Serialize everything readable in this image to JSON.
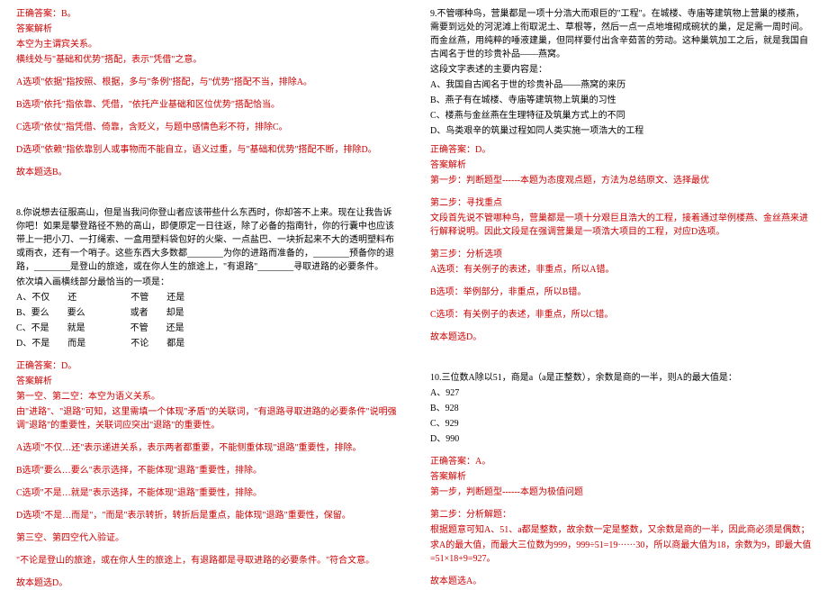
{
  "left": {
    "q7_answer_header": "正确答案：B。",
    "q7_explain_header": "答案解析",
    "q7_line1": "本空为主谓宾关系。",
    "q7_line2": "横线处与\"基础和优势\"搭配，表示\"凭借\"之意。",
    "q7_optA": "A选项\"依据\"指按照、根据，多与\"条例\"搭配，与\"优势\"搭配不当，排除A。",
    "q7_optB": "B选项\"依托\"指依靠、凭借，\"依托产业基础和区位优势\"搭配恰当。",
    "q7_optC": "C选项\"依仗\"指凭借、倚靠，含贬义，与题中感情色彩不符，排除C。",
    "q7_optD": "D选项\"依赖\"指依靠别人或事物而不能自立，语义过重，与\"基础和优势\"搭配不断，排除D。",
    "q7_conclusion": "故本题选B。",
    "q8_num": "8.",
    "q8_text": "你说想去征服高山，但是当我问你登山者应该带些什么东西时，你却答不上来。现在让我告诉你吧！如果是攀登路径不熟的高山，即便原定一日往返，除了必备的指南针，你的行囊中也应该带上一把小刀、一打绳索、一盒用塑料袋包好的火柴、一点盐巴、一块折起来不大的透明塑料布或雨衣，还有一个哨子。这些东西大多数都________为你的进路而准备的，________预备你的退路，________是登山的旅途，或在你人生的旅途上，\"有退路\"________寻取进路的必要条件。",
    "q8_prompt": "依次填入画横线部分最恰当的一项是：",
    "q8_rowA": "A、不仅　　还　　　　　　不管　　还是",
    "q8_rowB": "B、要么　　要么　　　　　或者　　却是",
    "q8_rowC": "C、不是　　就是　　　　　不管　　还是",
    "q8_rowD": "D、不是　　而是　　　　　不论　　都是",
    "q8_answer_header": "正确答案：D。",
    "q8_explain_header": "答案解析",
    "q8_line1": "第一空、第二空：本空为语义关系。",
    "q8_line2": "由\"进路\"、\"退路\"可知，这里需填一个体现\"矛盾\"的关联词，\"有退路寻取进路的必要条件\"说明强调\"退路\"的重要性，关联词应突出\"退路\"的重要性。",
    "q8_optA": "A选项\"不仅…还\"表示递进关系，表示两者都重要，不能侧重体现\"退路\"重要性，排除。",
    "q8_optB": "B选项\"要么…要么\"表示选择，不能体现\"退路\"重要性，排除。",
    "q8_optC": "C选项\"不是…就是\"表示选择，不能体现\"退路\"重要性，排除。",
    "q8_optD": "D选项\"不是…而是\"，\"而是\"表示转折，转折后是重点，能体现\"退路\"重要性，保留。",
    "q8_line3": "第三空、第四空代入验证。",
    "q8_line4": "\"不论是登山的旅途，或在你人生的旅途上，有退路都是寻取进路的必要条件。\"符合文意。",
    "q8_conclusion": "故本题选D。"
  },
  "right": {
    "q9_num": "9.",
    "q9_text": "不管哪种鸟，营巢都是一项十分浩大而艰巨的\"工程\"。在城楼、寺庙等建筑物上营巢的楼燕，需要到远处的河泥滩上衔取泥土、草根等，然后一点一点地堆砌成碗状的巢，足足需一周时间。而金丝燕，用纯粹的唾液建巢，但同样要付出含辛茹苦的劳动。这种巢筑加工之后，就是我国自古闻名于世的珍贵补品——燕窝。",
    "q9_prompt": "这段文字表述的主要内容是：",
    "q9_optA_q": "A、我国自古闻名于世的珍贵补品——燕窝的来历",
    "q9_optB_q": "B、燕子有在城楼、寺庙等建筑物上筑巢的习性",
    "q9_optC_q": "C、楼燕与金丝燕在生理特征及筑巢方式上的不同",
    "q9_optD_q": "D、鸟类艰辛的筑巢过程如同人类实施一项浩大的工程",
    "q9_answer_header": "正确答案：D。",
    "q9_explain_header": "答案解析",
    "q9_step1": "第一步：判断题型------本题为态度观点题，方法为总结原文、选择最优",
    "q9_step2": "第二步：寻找重点",
    "q9_line1": "文段首先说不管哪种鸟，营巢都是一项十分艰巨且浩大的工程，接着通过举例楼燕、金丝燕来进行解释说明。因此文段是在强调营巢是一项浩大项目的工程，对应D选项。",
    "q9_step3": "第三步：分析选项",
    "q9_optA": "A选项：有关例子的表述，非重点，所以A错。",
    "q9_optB": "B选项：举例部分，非重点，所以B错。",
    "q9_optC": "C选项：有关例子的表述，非重点，所以C错。",
    "q9_conclusion": "故本题选D。",
    "q10_num": "10.",
    "q10_text": "三位数A除以51，商是a（a是正整数），余数是商的一半，则A的最大值是：",
    "q10_optA_q": "A、927",
    "q10_optB_q": "B、928",
    "q10_optC_q": "C、929",
    "q10_optD_q": "D、990",
    "q10_answer_header": "正确答案：A。",
    "q10_explain_header": "答案解析",
    "q10_step1": "第一步，判断题型------本题为极值问题",
    "q10_step2": "第二步：分析解题：",
    "q10_line1": "根据题意可知A、51、a都是整数，故余数一定是整数，又余数是商的一半，因此商必须是偶数；",
    "q10_line2": "求A的最大值，而最大三位数为999，999÷51=19······30，所以商最大值为18，余数为9，即最大值=51×18+9=927。",
    "q10_conclusion": "故本题选A。"
  }
}
